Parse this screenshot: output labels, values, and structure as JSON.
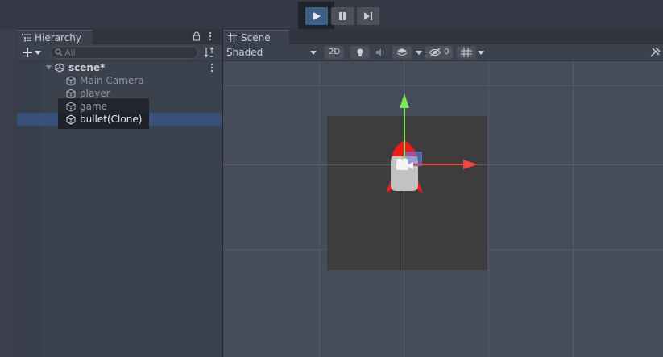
{
  "toolbar": {
    "play": {
      "icon": "play-icon",
      "active": true
    },
    "pause": {
      "icon": "pause-icon"
    },
    "step": {
      "icon": "step-icon"
    }
  },
  "hierarchy": {
    "tab_label": "Hierarchy",
    "search_placeholder": "All",
    "scene_name": "scene*",
    "items": [
      {
        "label": "Main Camera",
        "selected": false
      },
      {
        "label": "player",
        "selected": false
      },
      {
        "label": "game",
        "selected": false
      },
      {
        "label": "bullet(Clone)",
        "selected": true
      }
    ]
  },
  "scene": {
    "tab_label": "Scene",
    "shading_mode": "Shaded",
    "mode_2d_label": "2D",
    "hidden_count": "0"
  },
  "colors": {
    "accent_blue": "#3d5f85",
    "gizmo_y": "#7fe35a",
    "gizmo_x": "#f0483e",
    "rocket_fin": "#ee1c1c",
    "rocket_body": "#c2c2c2"
  }
}
